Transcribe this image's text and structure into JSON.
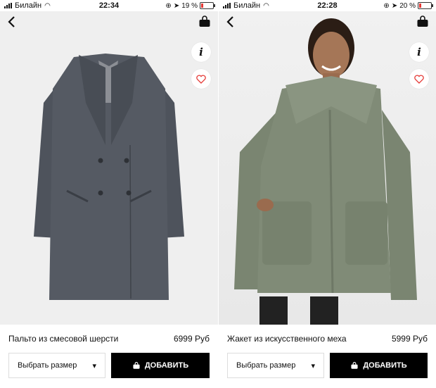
{
  "screens": [
    {
      "status": {
        "carrier": "Билайн",
        "time": "22:34",
        "battery": "19 %",
        "battery_level": 0.19
      },
      "product": {
        "name": "Пальто из смесовой шерсти",
        "price": "6999 Руб"
      },
      "size_select": {
        "label": "Выбрать размер"
      },
      "add_button": {
        "label": "ДОБАВИТЬ"
      },
      "info_icon": "i"
    },
    {
      "status": {
        "carrier": "Билайн",
        "time": "22:28",
        "battery": "20 %",
        "battery_level": 0.2
      },
      "product": {
        "name": "Жакет из искусственного меха",
        "price": "5999 Руб"
      },
      "size_select": {
        "label": "Выбрать размер"
      },
      "add_button": {
        "label": "ДОБАВИТЬ"
      },
      "info_icon": "i"
    }
  ],
  "colors": {
    "coat": "#4a4f58",
    "fur": "#7e8975",
    "button": "#000000",
    "heart": "#e53935"
  }
}
